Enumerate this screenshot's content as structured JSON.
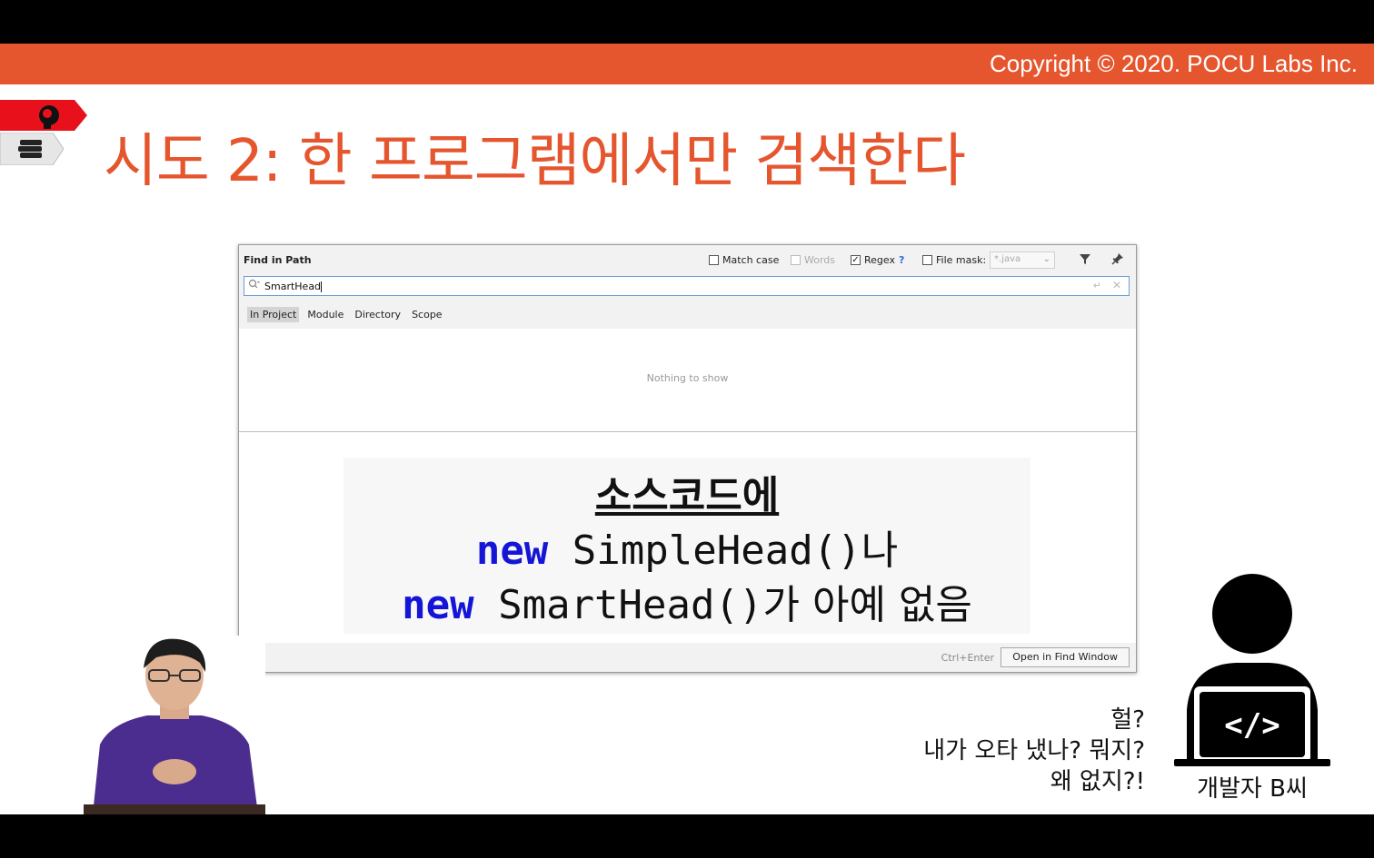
{
  "header": {
    "copyright": "Copyright © 2020. POCU Labs Inc.",
    "accent_color": "#e5562e"
  },
  "slide": {
    "title": "시도 2: 한 프로그램에서만 검색한다"
  },
  "dialog": {
    "title": "Find in Path",
    "options": {
      "match_case": "Match case",
      "words": "Words",
      "regex": "Regex",
      "regex_help": "?",
      "file_mask": "File mask:",
      "file_mask_value": "*.java"
    },
    "search_value": "SmartHead",
    "scopes": [
      "In Project",
      "Module",
      "Directory",
      "Scope"
    ],
    "empty_text": "Nothing to show",
    "shortcut_hint": "Ctrl+Enter",
    "open_button": "Open in Find Window"
  },
  "overlay": {
    "line1": "소스코드에",
    "line2_kw": "new",
    "line2_rest": " SimpleHead()",
    "line2_kr": "나",
    "line3_kw": "new",
    "line3_rest": " SmartHead()",
    "line3_kr": "가 아예 없음"
  },
  "developer": {
    "speech": [
      "헐?",
      "내가 오타 냈나? 뭐지?",
      "왜 없지?!"
    ],
    "caption": "개발자 B씨",
    "screen_symbol": "</>"
  }
}
